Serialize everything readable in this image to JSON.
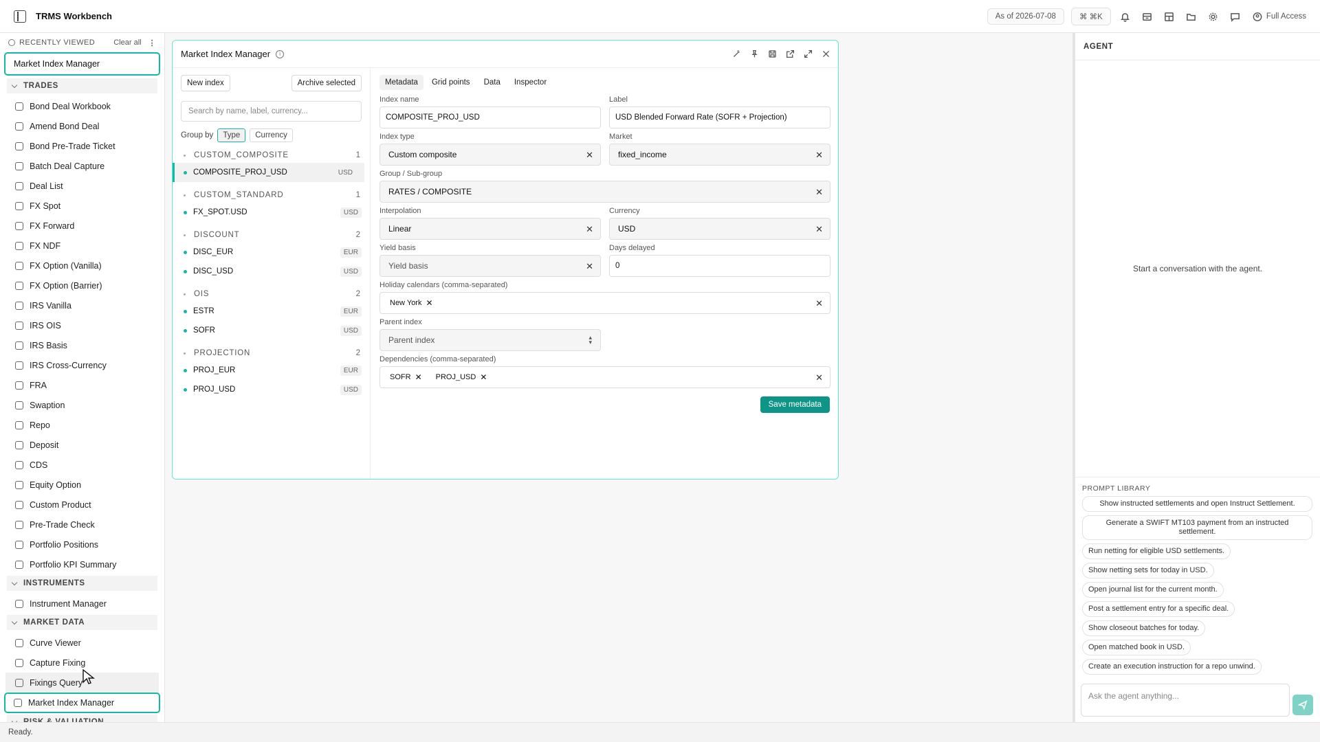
{
  "app": {
    "title": "TRMS Workbench",
    "as_of": "As of 2026-07-08",
    "shortcut": "⌘ ⌘K",
    "access": "Full Access",
    "accent": "#14b8a6"
  },
  "sidebar": {
    "recent_title": "RECENTLY VIEWED",
    "clear_all": "Clear all",
    "recent_items": [
      "Market Index Manager"
    ],
    "sections": [
      {
        "title": "TRADES",
        "items": [
          "Bond Deal Workbook",
          "Amend Bond Deal",
          "Bond Pre-Trade Ticket",
          "Batch Deal Capture",
          "Deal List",
          "FX Spot",
          "FX Forward",
          "FX NDF",
          "FX Option (Vanilla)",
          "FX Option (Barrier)",
          "IRS Vanilla",
          "IRS OIS",
          "IRS Basis",
          "IRS Cross-Currency",
          "FRA",
          "Swaption",
          "Repo",
          "Deposit",
          "CDS",
          "Equity Option",
          "Custom Product",
          "Pre-Trade Check",
          "Portfolio Positions",
          "Portfolio KPI Summary"
        ]
      },
      {
        "title": "INSTRUMENTS",
        "items": [
          "Instrument Manager"
        ]
      },
      {
        "title": "MARKET DATA",
        "items": [
          "Curve Viewer",
          "Capture Fixing",
          "Fixings Query",
          "Market Index Manager"
        ]
      },
      {
        "title": "RISK & VALUATION",
        "items": []
      }
    ]
  },
  "window": {
    "title": "Market Index Manager",
    "new_index": "New index",
    "archive_selected": "Archive selected",
    "search_placeholder": "Search by name, label, currency...",
    "group_by_label": "Group by",
    "group_by_options": [
      "Type",
      "Currency"
    ],
    "groups": [
      {
        "name": "CUSTOM_COMPOSITE",
        "count": "1",
        "items": [
          {
            "name": "COMPOSITE_PROJ_USD",
            "ccy": "USD"
          }
        ]
      },
      {
        "name": "CUSTOM_STANDARD",
        "count": "1",
        "items": [
          {
            "name": "FX_SPOT.USD",
            "ccy": "USD"
          }
        ]
      },
      {
        "name": "DISCOUNT",
        "count": "2",
        "items": [
          {
            "name": "DISC_EUR",
            "ccy": "EUR"
          },
          {
            "name": "DISC_USD",
            "ccy": "USD"
          }
        ]
      },
      {
        "name": "OIS",
        "count": "2",
        "items": [
          {
            "name": "ESTR",
            "ccy": "EUR"
          },
          {
            "name": "SOFR",
            "ccy": "USD"
          }
        ]
      },
      {
        "name": "PROJECTION",
        "count": "2",
        "items": [
          {
            "name": "PROJ_EUR",
            "ccy": "EUR"
          },
          {
            "name": "PROJ_USD",
            "ccy": "USD"
          }
        ]
      }
    ],
    "tabs": [
      "Metadata",
      "Grid points",
      "Data",
      "Inspector"
    ],
    "form": {
      "index_name_label": "Index name",
      "index_name": "COMPOSITE_PROJ_USD",
      "label_label": "Label",
      "label": "USD Blended Forward Rate (SOFR + Projection)",
      "index_type_label": "Index type",
      "index_type": "Custom composite",
      "market_label": "Market",
      "market": "fixed_income",
      "group_label": "Group / Sub-group",
      "group": "RATES / COMPOSITE",
      "interpolation_label": "Interpolation",
      "interpolation": "Linear",
      "currency_label": "Currency",
      "currency": "USD",
      "yield_basis_label": "Yield basis",
      "yield_basis_placeholder": "Yield basis",
      "days_delayed_label": "Days delayed",
      "days_delayed": "0",
      "holiday_label": "Holiday calendars (comma-separated)",
      "holiday_tags": [
        "New York"
      ],
      "parent_label": "Parent index",
      "parent_placeholder": "Parent index",
      "deps_label": "Dependencies (comma-separated)",
      "deps_tags": [
        "SOFR",
        "PROJ_USD"
      ],
      "save": "Save metadata"
    }
  },
  "agent": {
    "title": "AGENT",
    "empty": "Start a conversation with the agent.",
    "prompt_title": "PROMPT LIBRARY",
    "prompts": [
      "Show instructed settlements and open Instruct Settlement.",
      "Generate a SWIFT MT103 payment from an instructed settlement.",
      "Run netting for eligible USD settlements.",
      "Show netting sets for today in USD.",
      "Open journal list for the current month.",
      "Post a settlement entry for a specific deal.",
      "Show closeout batches for today.",
      "Open matched book in USD.",
      "Create an execution instruction for a repo unwind."
    ],
    "input_placeholder": "Ask the agent anything..."
  },
  "status": "Ready."
}
